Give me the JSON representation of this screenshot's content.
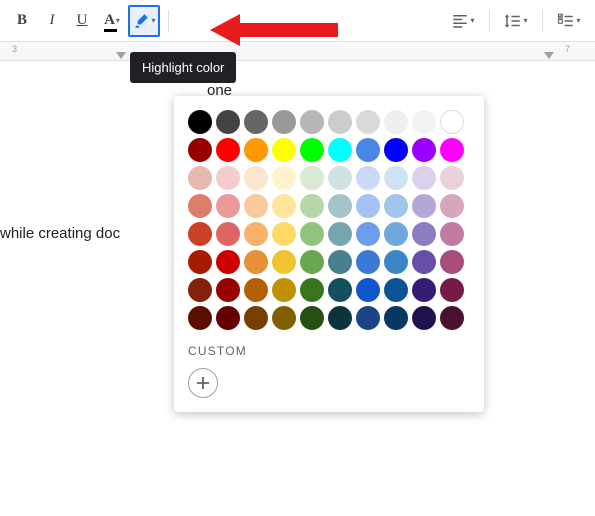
{
  "tooltip": {
    "label": "Highlight color"
  },
  "doc": {
    "line1": "one",
    "line2": "while creating doc"
  },
  "ruler": {
    "tick3": "3",
    "tick7": "7"
  },
  "picker": {
    "custom_label": "CUSTOM",
    "rows": [
      [
        "#000000",
        "#434343",
        "#666666",
        "#999999",
        "#b7b7b7",
        "#cccccc",
        "#d9d9d9",
        "#efefef",
        "#f3f3f3",
        "#ffffff"
      ],
      [
        "#980000",
        "#ff0000",
        "#ff9900",
        "#ffff00",
        "#00ff00",
        "#00ffff",
        "#4a86e8",
        "#0000ff",
        "#9900ff",
        "#ff00ff"
      ],
      [
        "#e6b8af",
        "#f4cccc",
        "#fce5cd",
        "#fff2cc",
        "#d9ead3",
        "#d0e0e3",
        "#c9daf8",
        "#cfe2f3",
        "#d9d2e9",
        "#ead1dc"
      ],
      [
        "#dd7e6b",
        "#ea9999",
        "#f9cb9c",
        "#ffe599",
        "#b6d7a8",
        "#a2c4c9",
        "#a4c2f4",
        "#9fc5e8",
        "#b4a7d6",
        "#d5a6bd"
      ],
      [
        "#cc4125",
        "#e06666",
        "#f6b26b",
        "#ffd966",
        "#93c47d",
        "#76a5af",
        "#6d9eeb",
        "#6fa8dc",
        "#8e7cc3",
        "#c27ba0"
      ],
      [
        "#a61c00",
        "#cc0000",
        "#e69138",
        "#f1c232",
        "#6aa84f",
        "#45818e",
        "#3c78d8",
        "#3d85c6",
        "#674ea7",
        "#a64d79"
      ],
      [
        "#85200c",
        "#990000",
        "#b45f06",
        "#bf9000",
        "#38761d",
        "#134f5c",
        "#1155cc",
        "#0b5394",
        "#351c75",
        "#741b47"
      ],
      [
        "#5b0f00",
        "#660000",
        "#783f04",
        "#7f6000",
        "#274e13",
        "#0c343d",
        "#1c4587",
        "#073763",
        "#20124d",
        "#4c1130"
      ]
    ]
  }
}
